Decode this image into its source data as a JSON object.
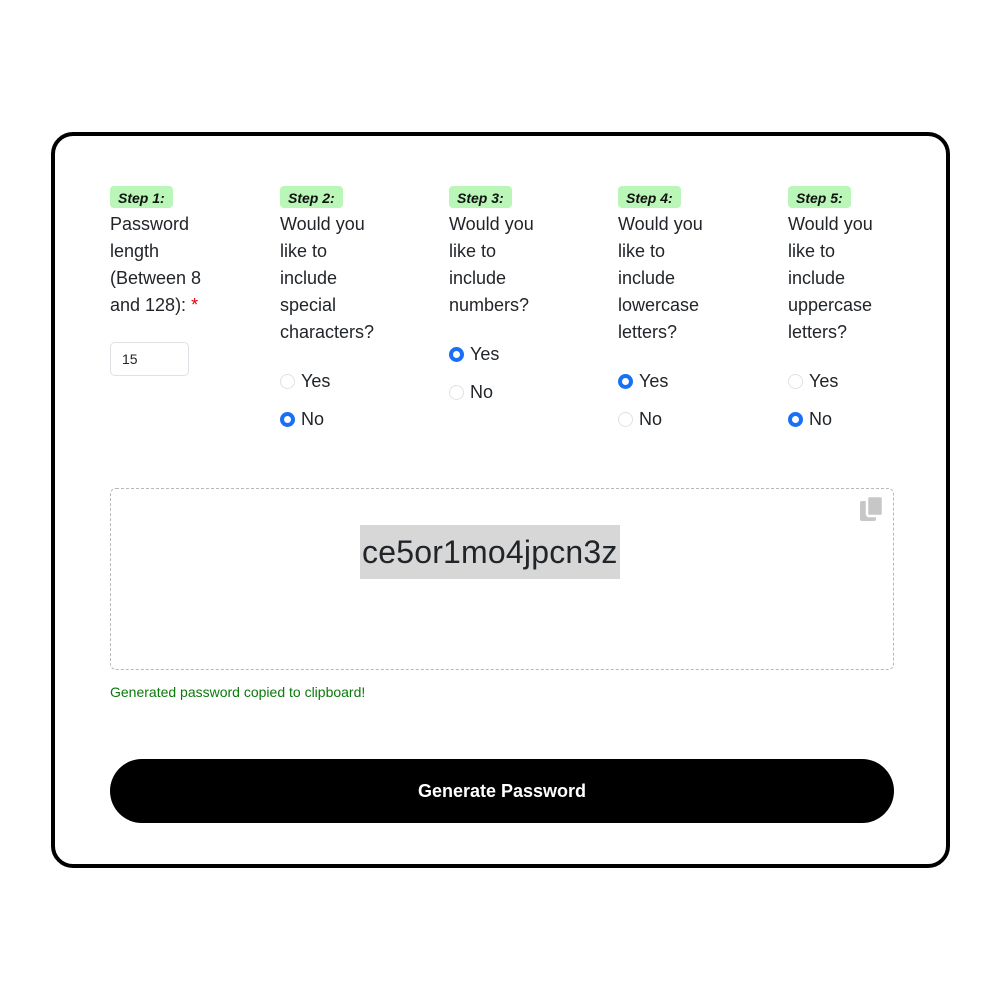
{
  "steps": [
    {
      "badge": "Step 1:",
      "question": "Password length (Between 8 and 128):",
      "required_mark": "*",
      "input_value": "15"
    },
    {
      "badge": "Step 2:",
      "question": "Would you like to include special characters?",
      "options": [
        "Yes",
        "No"
      ],
      "selected": "No"
    },
    {
      "badge": "Step 3:",
      "question": "Would you like to include numbers?",
      "options": [
        "Yes",
        "No"
      ],
      "selected": "Yes"
    },
    {
      "badge": "Step 4:",
      "question": "Would you like to include lowercase letters?",
      "options": [
        "Yes",
        "No"
      ],
      "selected": "Yes"
    },
    {
      "badge": "Step 5:",
      "question": "Would you like to include uppercase letters?",
      "options": [
        "Yes",
        "No"
      ],
      "selected": "No"
    }
  ],
  "output": {
    "password": "ce5or1mo4jpcn3z",
    "copy_icon": "copy-icon",
    "copied_message": "Generated password copied to clipboard!"
  },
  "generate_button": {
    "label": "Generate Password"
  },
  "colors": {
    "badge_bg": "#b9f6b8",
    "radio_accent": "#1a6ff7",
    "success_text": "#0a7a0a",
    "button_bg": "#000000",
    "required": "#e00000"
  }
}
